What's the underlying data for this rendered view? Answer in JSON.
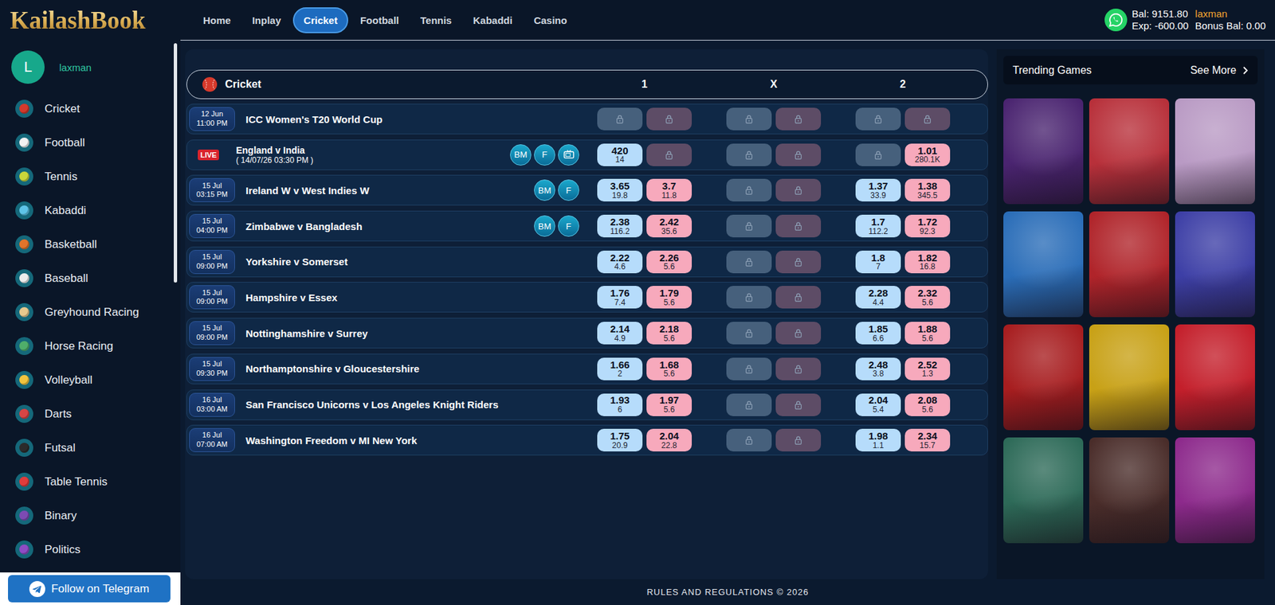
{
  "logo": "KailashBook",
  "nav": [
    {
      "label": "Home",
      "selected": false
    },
    {
      "label": "Inplay",
      "selected": false
    },
    {
      "label": "Cricket",
      "selected": true
    },
    {
      "label": "Football",
      "selected": false
    },
    {
      "label": "Tennis",
      "selected": false
    },
    {
      "label": "Kabaddi",
      "selected": false
    },
    {
      "label": "Casino",
      "selected": false
    }
  ],
  "account": {
    "balance": "Bal: 9151.80",
    "exposure": "Exp: -600.00",
    "username": "laxman",
    "bonus": "Bonus Bal: 0.00"
  },
  "user": {
    "avatar": "L",
    "name": "laxman"
  },
  "sidebar": {
    "items": [
      {
        "label": "Cricket",
        "color": "#d33a2c"
      },
      {
        "label": "Football",
        "color": "#f2f2f2"
      },
      {
        "label": "Tennis",
        "color": "#c9d63a"
      },
      {
        "label": "Kabaddi",
        "color": "#5ec4e8"
      },
      {
        "label": "Basketball",
        "color": "#e2742a"
      },
      {
        "label": "Baseball",
        "color": "#ececec"
      },
      {
        "label": "Greyhound Racing",
        "color": "#e7c98e"
      },
      {
        "label": "Horse Racing",
        "color": "#4fae6a"
      },
      {
        "label": "Volleyball",
        "color": "#f1c43f"
      },
      {
        "label": "Darts",
        "color": "#d84545"
      },
      {
        "label": "Futsal",
        "color": "#2b2b2b"
      },
      {
        "label": "Table Tennis",
        "color": "#e03c3c"
      },
      {
        "label": "Binary",
        "color": "#7c4bb3"
      },
      {
        "label": "Politics",
        "color": "#8e4cc4"
      }
    ]
  },
  "telegram_button": "Follow on Telegram",
  "market": {
    "title": "Cricket",
    "columns": [
      "1",
      "X",
      "2"
    ],
    "rows": [
      {
        "kind": "scheduled",
        "day": "12 Jun",
        "time": "11:00 PM",
        "name": "ICC Women's T20 World Cup",
        "badges": [],
        "tv": false,
        "odds": [
          {
            "kind": "back",
            "locked": true
          },
          {
            "kind": "lay",
            "locked": true
          },
          {
            "kind": "back",
            "locked": true
          },
          {
            "kind": "lay",
            "locked": true
          },
          {
            "kind": "back",
            "locked": true
          },
          {
            "kind": "lay",
            "locked": true
          }
        ]
      },
      {
        "kind": "live",
        "live_label": "LIVE",
        "name": "England v India",
        "subtitle": "( 14/07/26 03:30 PM )",
        "badges": [
          "BM",
          "F"
        ],
        "tv": true,
        "odds": [
          {
            "kind": "back",
            "locked": false,
            "price": "420",
            "size": "14"
          },
          {
            "kind": "lay",
            "locked": true
          },
          {
            "kind": "back",
            "locked": true
          },
          {
            "kind": "lay",
            "locked": true
          },
          {
            "kind": "back",
            "locked": true
          },
          {
            "kind": "lay",
            "locked": false,
            "price": "1.01",
            "size": "280.1K"
          }
        ]
      },
      {
        "kind": "scheduled",
        "day": "15 Jul",
        "time": "03:15 PM",
        "name": "Ireland W v West Indies W",
        "badges": [
          "BM",
          "F"
        ],
        "tv": false,
        "odds": [
          {
            "kind": "back",
            "locked": false,
            "price": "3.65",
            "size": "19.8"
          },
          {
            "kind": "lay",
            "locked": false,
            "price": "3.7",
            "size": "11.8"
          },
          {
            "kind": "back",
            "locked": true
          },
          {
            "kind": "lay",
            "locked": true
          },
          {
            "kind": "back",
            "locked": false,
            "price": "1.37",
            "size": "33.9"
          },
          {
            "kind": "lay",
            "locked": false,
            "price": "1.38",
            "size": "345.5"
          }
        ]
      },
      {
        "kind": "scheduled",
        "day": "15 Jul",
        "time": "04:00 PM",
        "name": "Zimbabwe v Bangladesh",
        "badges": [
          "BM",
          "F"
        ],
        "tv": false,
        "odds": [
          {
            "kind": "back",
            "locked": false,
            "price": "2.38",
            "size": "116.2"
          },
          {
            "kind": "lay",
            "locked": false,
            "price": "2.42",
            "size": "35.6"
          },
          {
            "kind": "back",
            "locked": true
          },
          {
            "kind": "lay",
            "locked": true
          },
          {
            "kind": "back",
            "locked": false,
            "price": "1.7",
            "size": "112.2"
          },
          {
            "kind": "lay",
            "locked": false,
            "price": "1.72",
            "size": "92.3"
          }
        ]
      },
      {
        "kind": "scheduled",
        "day": "15 Jul",
        "time": "09:00 PM",
        "name": "Yorkshire v Somerset",
        "badges": [],
        "tv": false,
        "odds": [
          {
            "kind": "back",
            "locked": false,
            "price": "2.22",
            "size": "4.6"
          },
          {
            "kind": "lay",
            "locked": false,
            "price": "2.26",
            "size": "5.6"
          },
          {
            "kind": "back",
            "locked": true
          },
          {
            "kind": "lay",
            "locked": true
          },
          {
            "kind": "back",
            "locked": false,
            "price": "1.8",
            "size": "7"
          },
          {
            "kind": "lay",
            "locked": false,
            "price": "1.82",
            "size": "16.8"
          }
        ]
      },
      {
        "kind": "scheduled",
        "day": "15 Jul",
        "time": "09:00 PM",
        "name": "Hampshire v Essex",
        "badges": [],
        "tv": false,
        "odds": [
          {
            "kind": "back",
            "locked": false,
            "price": "1.76",
            "size": "7.4"
          },
          {
            "kind": "lay",
            "locked": false,
            "price": "1.79",
            "size": "5.6"
          },
          {
            "kind": "back",
            "locked": true
          },
          {
            "kind": "lay",
            "locked": true
          },
          {
            "kind": "back",
            "locked": false,
            "price": "2.28",
            "size": "4.4"
          },
          {
            "kind": "lay",
            "locked": false,
            "price": "2.32",
            "size": "5.6"
          }
        ]
      },
      {
        "kind": "scheduled",
        "day": "15 Jul",
        "time": "09:00 PM",
        "name": "Nottinghamshire v Surrey",
        "badges": [],
        "tv": false,
        "odds": [
          {
            "kind": "back",
            "locked": false,
            "price": "2.14",
            "size": "4.9"
          },
          {
            "kind": "lay",
            "locked": false,
            "price": "2.18",
            "size": "5.6"
          },
          {
            "kind": "back",
            "locked": true
          },
          {
            "kind": "lay",
            "locked": true
          },
          {
            "kind": "back",
            "locked": false,
            "price": "1.85",
            "size": "6.6"
          },
          {
            "kind": "lay",
            "locked": false,
            "price": "1.88",
            "size": "5.6"
          }
        ]
      },
      {
        "kind": "scheduled",
        "day": "15 Jul",
        "time": "09:30 PM",
        "name": "Northamptonshire v Gloucestershire",
        "badges": [],
        "tv": false,
        "odds": [
          {
            "kind": "back",
            "locked": false,
            "price": "1.66",
            "size": "2"
          },
          {
            "kind": "lay",
            "locked": false,
            "price": "1.68",
            "size": "5.6"
          },
          {
            "kind": "back",
            "locked": true
          },
          {
            "kind": "lay",
            "locked": true
          },
          {
            "kind": "back",
            "locked": false,
            "price": "2.48",
            "size": "3.8"
          },
          {
            "kind": "lay",
            "locked": false,
            "price": "2.52",
            "size": "1.3"
          }
        ]
      },
      {
        "kind": "scheduled",
        "day": "16 Jul",
        "time": "03:00 AM",
        "name": "San Francisco Unicorns v Los Angeles Knight Riders",
        "badges": [],
        "tv": false,
        "odds": [
          {
            "kind": "back",
            "locked": false,
            "price": "1.93",
            "size": "6"
          },
          {
            "kind": "lay",
            "locked": false,
            "price": "1.97",
            "size": "5.6"
          },
          {
            "kind": "back",
            "locked": true
          },
          {
            "kind": "lay",
            "locked": true
          },
          {
            "kind": "back",
            "locked": false,
            "price": "2.04",
            "size": "5.4"
          },
          {
            "kind": "lay",
            "locked": false,
            "price": "2.08",
            "size": "5.6"
          }
        ]
      },
      {
        "kind": "scheduled",
        "day": "16 Jul",
        "time": "07:00 AM",
        "name": "Washington Freedom v MI New York",
        "badges": [],
        "tv": false,
        "odds": [
          {
            "kind": "back",
            "locked": false,
            "price": "1.75",
            "size": "20.9"
          },
          {
            "kind": "lay",
            "locked": false,
            "price": "2.04",
            "size": "22.8"
          },
          {
            "kind": "back",
            "locked": true
          },
          {
            "kind": "lay",
            "locked": true
          },
          {
            "kind": "back",
            "locked": false,
            "price": "1.98",
            "size": "1.1"
          },
          {
            "kind": "lay",
            "locked": false,
            "price": "2.34",
            "size": "15.7"
          }
        ]
      }
    ]
  },
  "trending": {
    "title": "Trending Games",
    "see_more": "See More",
    "tiles": [
      {
        "color": "#4a2470"
      },
      {
        "color": "#b8303a"
      },
      {
        "color": "#b99ac4"
      },
      {
        "color": "#2a6db8"
      },
      {
        "color": "#b0242a"
      },
      {
        "color": "#3d3fa6"
      },
      {
        "color": "#a71d1f"
      },
      {
        "color": "#c8a116"
      },
      {
        "color": "#c41f2b"
      },
      {
        "color": "#2d6a58"
      },
      {
        "color": "#4a2d2a"
      },
      {
        "color": "#8d2a8c"
      }
    ]
  },
  "footer": "RULES AND REGULATIONS © 2026"
}
